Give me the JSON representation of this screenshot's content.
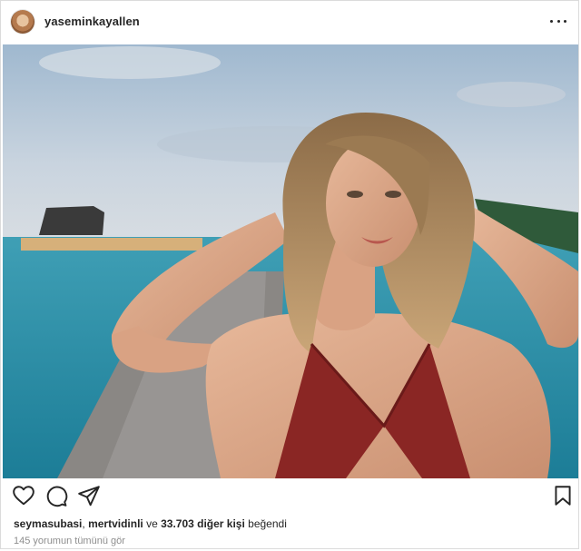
{
  "post": {
    "username": "yaseminkayallen",
    "image_alt": "",
    "likes": {
      "user1": "seymasubasi",
      "separator": ", ",
      "user2": "mertvidinli",
      "conj": " ve ",
      "count_text": "33.703 diğer kişi",
      "suffix": " beğendi"
    },
    "comments_link": "145 yorumun tümünü gör"
  },
  "icons": {
    "more": "more-options-icon",
    "like": "heart-icon",
    "comment": "comment-icon",
    "share": "share-icon",
    "save": "bookmark-icon"
  },
  "colors": {
    "text": "#262626",
    "muted": "#8e8e8e",
    "border": "#dbdbdb"
  }
}
